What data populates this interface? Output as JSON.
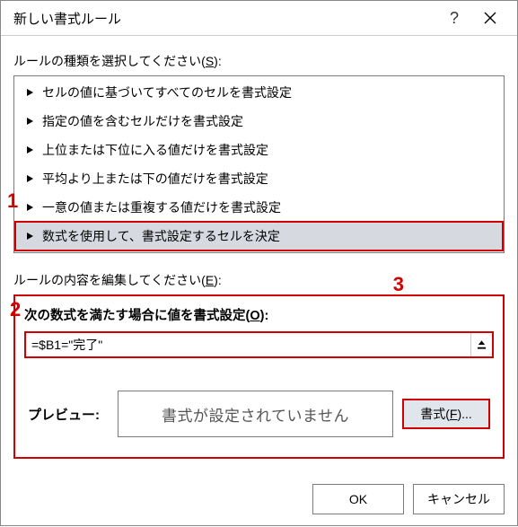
{
  "title": "新しい書式ルール",
  "select_label_pre": "ルールの種類を選択してください(",
  "select_label_key": "S",
  "select_label_post": "):",
  "rule_types": [
    "セルの値に基づいてすべてのセルを書式設定",
    "指定の値を含むセルだけを書式設定",
    "上位または下位に入る値だけを書式設定",
    "平均より上または下の値だけを書式設定",
    "一意の値または重複する値だけを書式設定",
    "数式を使用して、書式設定するセルを決定"
  ],
  "edit_label_pre": "ルールの内容を編集してください(",
  "edit_label_key": "E",
  "edit_label_post": "):",
  "formula_heading_pre": "次の数式を満たす場合に値を書式設定(",
  "formula_heading_key": "O",
  "formula_heading_post": "):",
  "formula_value": "=$B1=\"完了\"",
  "preview_label": "プレビュー:",
  "preview_text": "書式が設定されていません",
  "format_button_pre": "書式(",
  "format_button_key": "F",
  "format_button_post": ")...",
  "ok": "OK",
  "cancel": "キャンセル",
  "callouts": {
    "c1": "1",
    "c2": "2",
    "c3": "3"
  }
}
